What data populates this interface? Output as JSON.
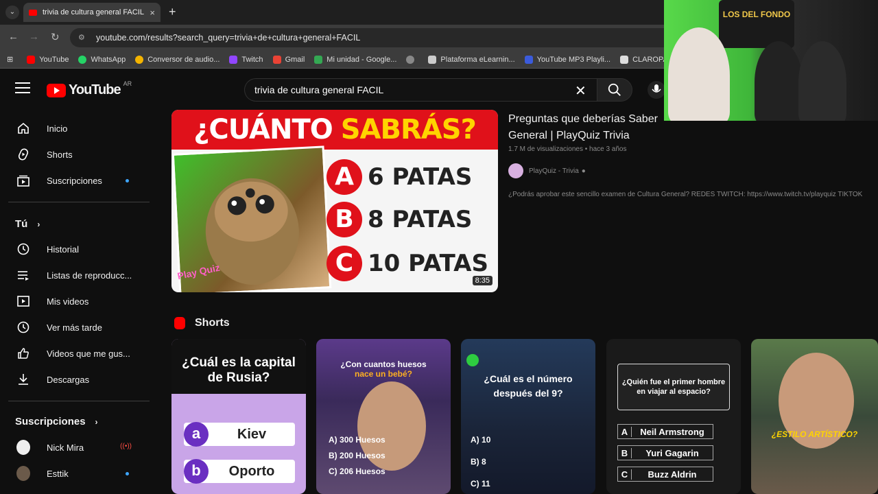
{
  "browser": {
    "tab_title": "trivia de cultura general FACIL",
    "tab_close": "×",
    "new_tab": "+",
    "url": "youtube.com/results?search_query=trivia+de+cultura+general+FACIL",
    "bookmarks": [
      {
        "label": "YouTube",
        "color": "#ff0000"
      },
      {
        "label": "WhatsApp",
        "color": "#25d366"
      },
      {
        "label": "Conversor de audio...",
        "color": "#f4b400"
      },
      {
        "label": "Twitch",
        "color": "#9146ff"
      },
      {
        "label": "Gmail",
        "color": "#ea4335"
      },
      {
        "label": "Mi unidad - Google...",
        "color": "#34a853"
      },
      {
        "label": "",
        "color": "#888888"
      },
      {
        "label": "Plataforma eLearnin...",
        "color": "#cccccc"
      },
      {
        "label": "YouTube MP3 Playli...",
        "color": "#3b5bdb"
      },
      {
        "label": "CLAROPAY_TR",
        "color": "#dddddd"
      }
    ]
  },
  "youtube": {
    "logo_text": "YouTube",
    "country_code": "AR",
    "search_value": "trivia de cultura general FACIL"
  },
  "sidebar": {
    "main": [
      {
        "label": "Inicio",
        "icon": "home-icon"
      },
      {
        "label": "Shorts",
        "icon": "shorts-icon"
      },
      {
        "label": "Suscripciones",
        "icon": "subscriptions-icon"
      }
    ],
    "you_header": "Tú",
    "you": [
      {
        "label": "Historial",
        "icon": "history-icon"
      },
      {
        "label": "Listas de reproducc...",
        "icon": "playlist-icon"
      },
      {
        "label": "Mis videos",
        "icon": "my-videos-icon"
      },
      {
        "label": "Ver más tarde",
        "icon": "watch-later-icon"
      },
      {
        "label": "Videos que me gus...",
        "icon": "like-icon"
      },
      {
        "label": "Descargas",
        "icon": "download-icon"
      }
    ],
    "subs_header": "Suscripciones",
    "subs": [
      {
        "label": "Nick Mira"
      },
      {
        "label": "Esttik"
      }
    ]
  },
  "video": {
    "thumb_title_part1": "¿CUÁNTO",
    "thumb_title_part2": "SABRÁS?",
    "options": [
      {
        "letter": "A",
        "text": "6 PATAS"
      },
      {
        "letter": "B",
        "text": "8 PATAS"
      },
      {
        "letter": "C",
        "text": "10 PATAS"
      }
    ],
    "brand": "Play Quiz",
    "duration": "8:35",
    "title": "Preguntas que deberías Saber General | PlayQuiz Trivia",
    "meta": "1.7 M de visualizaciones • hace 3 años",
    "channel": "PlayQuiz - Trivia",
    "description": "¿Podrás aprobar este sencillo examen de Cultura General? REDES TWITCH: https://www.twitch.tv/playquiz TIKTOK"
  },
  "shorts": {
    "header": "Shorts",
    "items": [
      {
        "question": "¿Cuál es la capital de Rusia?",
        "options": [
          {
            "letter": "a",
            "text": "Kiev"
          },
          {
            "letter": "b",
            "text": "Oporto"
          }
        ]
      },
      {
        "question": "¿Con cuantos huesos",
        "question2": "nace un bebé?",
        "options": [
          {
            "letter": "A)",
            "text": "300 Huesos"
          },
          {
            "letter": "B)",
            "text": "200 Huesos"
          },
          {
            "letter": "C)",
            "text": "206 Huesos"
          }
        ]
      },
      {
        "question": "¿Cuál es el número después del 9?",
        "options": [
          {
            "letter": "A)",
            "text": "10"
          },
          {
            "letter": "B)",
            "text": "8"
          },
          {
            "letter": "C)",
            "text": "11"
          }
        ]
      },
      {
        "question": "¿Quién fue el primer hombre en viajar al espacio?",
        "options": [
          {
            "letter": "A",
            "text": "Neil Armstrong"
          },
          {
            "letter": "B",
            "text": "Yuri Gagarin"
          },
          {
            "letter": "C",
            "text": "Buzz Aldrin"
          }
        ]
      },
      {
        "caption": "¿ESTILO ARTÍSTICO?"
      }
    ]
  },
  "webcam_text": "LOS DEL FONDO"
}
